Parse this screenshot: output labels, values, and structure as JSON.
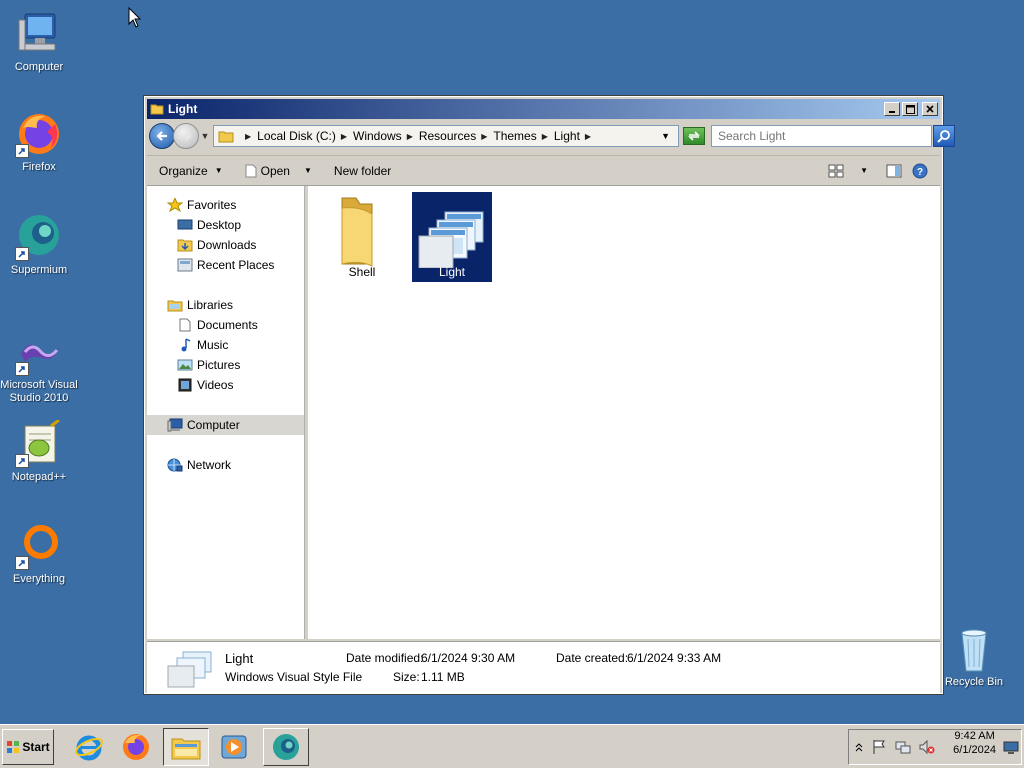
{
  "desktop": {
    "icons": [
      {
        "label": "Computer",
        "icon": "computer-icon"
      },
      {
        "label": "Firefox",
        "icon": "firefox-icon"
      },
      {
        "label": "Supermium",
        "icon": "supermium-icon"
      },
      {
        "label": "Microsoft Visual Studio 2010",
        "icon": "visual-studio-icon"
      },
      {
        "label": "Notepad++",
        "icon": "notepadpp-icon"
      },
      {
        "label": "Everything",
        "icon": "everything-icon"
      },
      {
        "label": "Recycle Bin",
        "icon": "recycle-bin-icon"
      }
    ]
  },
  "window": {
    "title": "Light",
    "breadcrumbs": [
      "Local Disk (C:)",
      "Windows",
      "Resources",
      "Themes",
      "Light"
    ],
    "search_placeholder": "Search Light",
    "toolbar": {
      "organize": "Organize",
      "open": "Open",
      "new_folder": "New folder"
    },
    "nav": {
      "favorites": "Favorites",
      "desktop": "Desktop",
      "downloads": "Downloads",
      "recent_places": "Recent Places",
      "libraries": "Libraries",
      "documents": "Documents",
      "music": "Music",
      "pictures": "Pictures",
      "videos": "Videos",
      "computer": "Computer",
      "network": "Network"
    },
    "files": [
      {
        "name": "Shell",
        "type": "folder",
        "selected": false
      },
      {
        "name": "Light",
        "type": "visual-style",
        "selected": true
      }
    ],
    "details": {
      "name": "Light",
      "type": "Windows Visual Style File",
      "date_modified_label": "Date modified:",
      "date_modified": "6/1/2024 9:30 AM",
      "size_label": "Size:",
      "size": "1.11 MB",
      "date_created_label": "Date created:",
      "date_created": "6/1/2024 9:33 AM"
    }
  },
  "taskbar": {
    "start_label": "Start",
    "pinned": [
      "internet-explorer-icon",
      "firefox-icon",
      "explorer-icon",
      "media-player-icon",
      "supermium-icon"
    ],
    "clock_time": "9:42 AM",
    "clock_date": "6/1/2024"
  },
  "colors": {
    "desktop": "#3a6ea5",
    "titlebar_start": "#0a246a",
    "titlebar_end": "#a6caf0",
    "selection": "#0a246a",
    "chrome": "#d4d0c8"
  }
}
